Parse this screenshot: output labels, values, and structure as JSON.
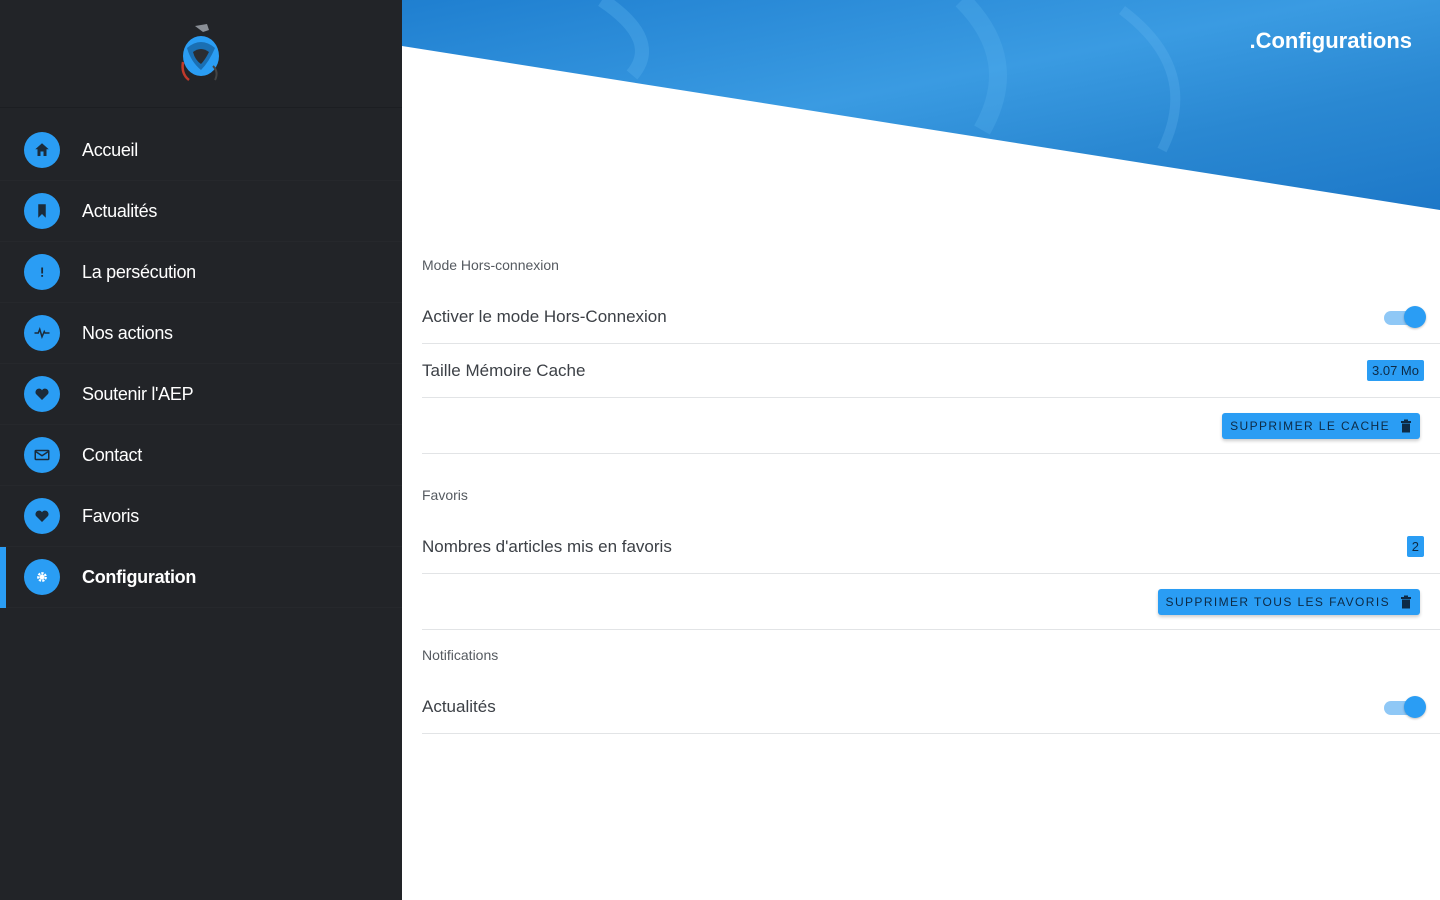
{
  "sidebar": {
    "items": [
      {
        "label": "Accueil",
        "icon": "home-icon"
      },
      {
        "label": "Actualités",
        "icon": "bookmark-icon"
      },
      {
        "label": "La persécution",
        "icon": "alert-icon"
      },
      {
        "label": "Nos actions",
        "icon": "pulse-icon"
      },
      {
        "label": "Soutenir l'AEP",
        "icon": "heart-icon"
      },
      {
        "label": "Contact",
        "icon": "mail-icon"
      },
      {
        "label": "Favoris",
        "icon": "heart-icon"
      },
      {
        "label": "Configuration",
        "icon": "gear-icon",
        "active": true
      }
    ]
  },
  "header": {
    "title": ".Configurations"
  },
  "offline": {
    "section_title": "Mode Hors-connexion",
    "toggle_label": "Activer le mode Hors-Connexion",
    "toggle_on": true,
    "cache_label": "Taille Mémoire Cache",
    "cache_value": "3.07 Mo",
    "clear_button": "SUPPRIMER LE CACHE"
  },
  "favorites": {
    "section_title": "Favoris",
    "count_label": "Nombres d'articles mis en favoris",
    "count_value": "2",
    "clear_button": "SUPPRIMER TOUS LES FAVORIS"
  },
  "notifications": {
    "section_title": "Notifications",
    "news_label": "Actualités",
    "news_on": true
  },
  "colors": {
    "accent": "#2a9df4",
    "sidebar_bg": "#222428",
    "header_blue": "#2a86cf"
  }
}
